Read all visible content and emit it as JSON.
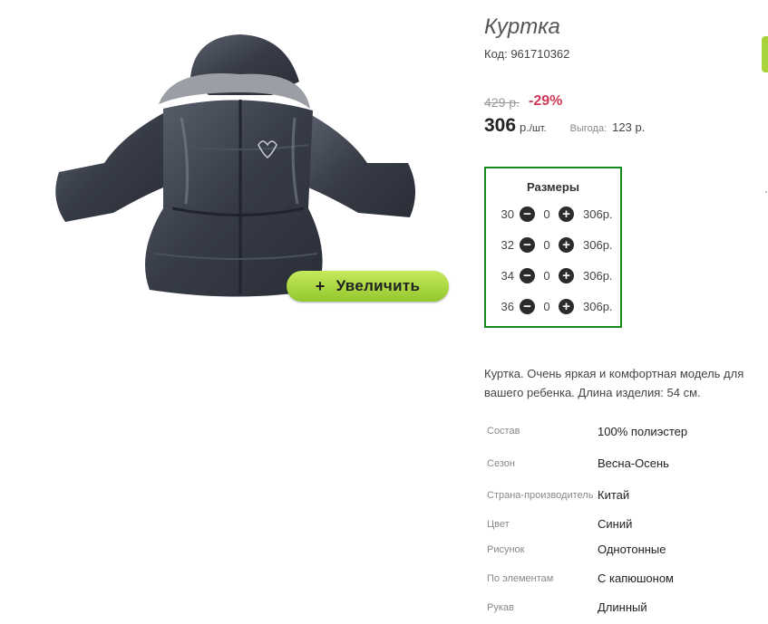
{
  "product": {
    "title": "Куртка",
    "code": "Код: 961710362",
    "old_price": "429 р.",
    "discount": "-29%",
    "price": "306",
    "unit": "р.",
    "unit_per": "/шт.",
    "save_label": "Выгода:",
    "save_value": "123 р.",
    "zoom_label": "Увеличить",
    "zoom_plus": "+",
    "description_line1": "Куртка. Очень яркая и комфортная модель для",
    "description_line2": "вашего ребенка. Длина изделия: 54 см."
  },
  "sizes": {
    "title": "Размеры",
    "items": [
      {
        "size": "30",
        "qty": "0",
        "price": "306р."
      },
      {
        "size": "32",
        "qty": "0",
        "price": "306р."
      },
      {
        "size": "34",
        "qty": "0",
        "price": "306р."
      },
      {
        "size": "36",
        "qty": "0",
        "price": "306р."
      }
    ],
    "minus": "−",
    "plus": "+"
  },
  "properties": [
    {
      "label": "Состав",
      "value": "100% полиэстер"
    },
    {
      "label": "Сезон",
      "value": "Весна-Осень"
    },
    {
      "label": "Страна-производитель",
      "value": "Китай"
    },
    {
      "label": "Цвет",
      "value": "Синий"
    },
    {
      "label": "Рисунок",
      "value": "Однотонные"
    },
    {
      "label": "По элементам",
      "value": "С капюшоном"
    },
    {
      "label": "Рукав",
      "value": "Длинный"
    }
  ],
  "colors": {
    "accent_green": "#138a1b",
    "button_green": "#a7d33b",
    "discount": "#d03a57",
    "jacket": "#3d4350"
  },
  "icons": {
    "minus": "minus-circle-icon",
    "plus": "plus-circle-icon"
  }
}
